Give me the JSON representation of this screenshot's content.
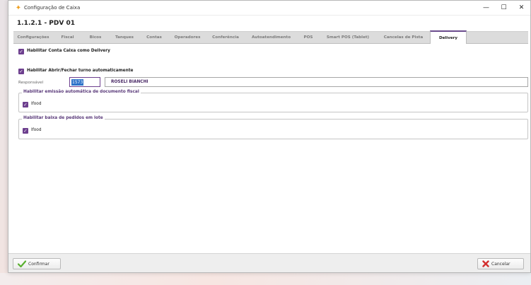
{
  "window": {
    "title": "Configuração de Caixa",
    "app_icon": "star-logo-icon",
    "controls": {
      "minimize": "—",
      "maximize": "☐",
      "close": "✕"
    }
  },
  "form": {
    "title": "1.1.2.1 - PDV 01"
  },
  "tabs": [
    {
      "label": "Configurações"
    },
    {
      "label": "Fiscal"
    },
    {
      "label": "Bicos"
    },
    {
      "label": "Tanques"
    },
    {
      "label": "Contas"
    },
    {
      "label": "Operadores"
    },
    {
      "label": "Conferência"
    },
    {
      "label": "Autoatendimento"
    },
    {
      "label": "POS"
    },
    {
      "label": "Smart POS (Tablet)"
    },
    {
      "label": "Cancelas de Pista"
    },
    {
      "label": "Delivery"
    }
  ],
  "active_tab": "Delivery",
  "delivery": {
    "enable_account_label": "Habilitar Conta Caixa como Delivery",
    "enable_account_checked": true,
    "auto_shift_label": "Habilitar Abrir/Fechar turno automaticamente",
    "auto_shift_checked": true,
    "responsible_label": "Responsável",
    "responsible_code": "1573",
    "responsible_name": "ROSELI BIANCHI",
    "fiscal_group": {
      "legend": "Habilitar emissão automática de documento fiscal",
      "items": [
        {
          "label": "Ifood",
          "checked": true
        }
      ]
    },
    "batch_group": {
      "legend": "Habilitar baixa de pedidos em lote",
      "items": [
        {
          "label": "Ifood",
          "checked": true
        }
      ]
    }
  },
  "footer": {
    "confirm_label": "Confirmar",
    "cancel_label": "Cancelar"
  },
  "colors": {
    "accent": "#6d3f8e",
    "selection": "#2d73c9",
    "confirm_icon": "#5ab030",
    "cancel_icon": "#d32f2f"
  },
  "checkmark": "✓"
}
